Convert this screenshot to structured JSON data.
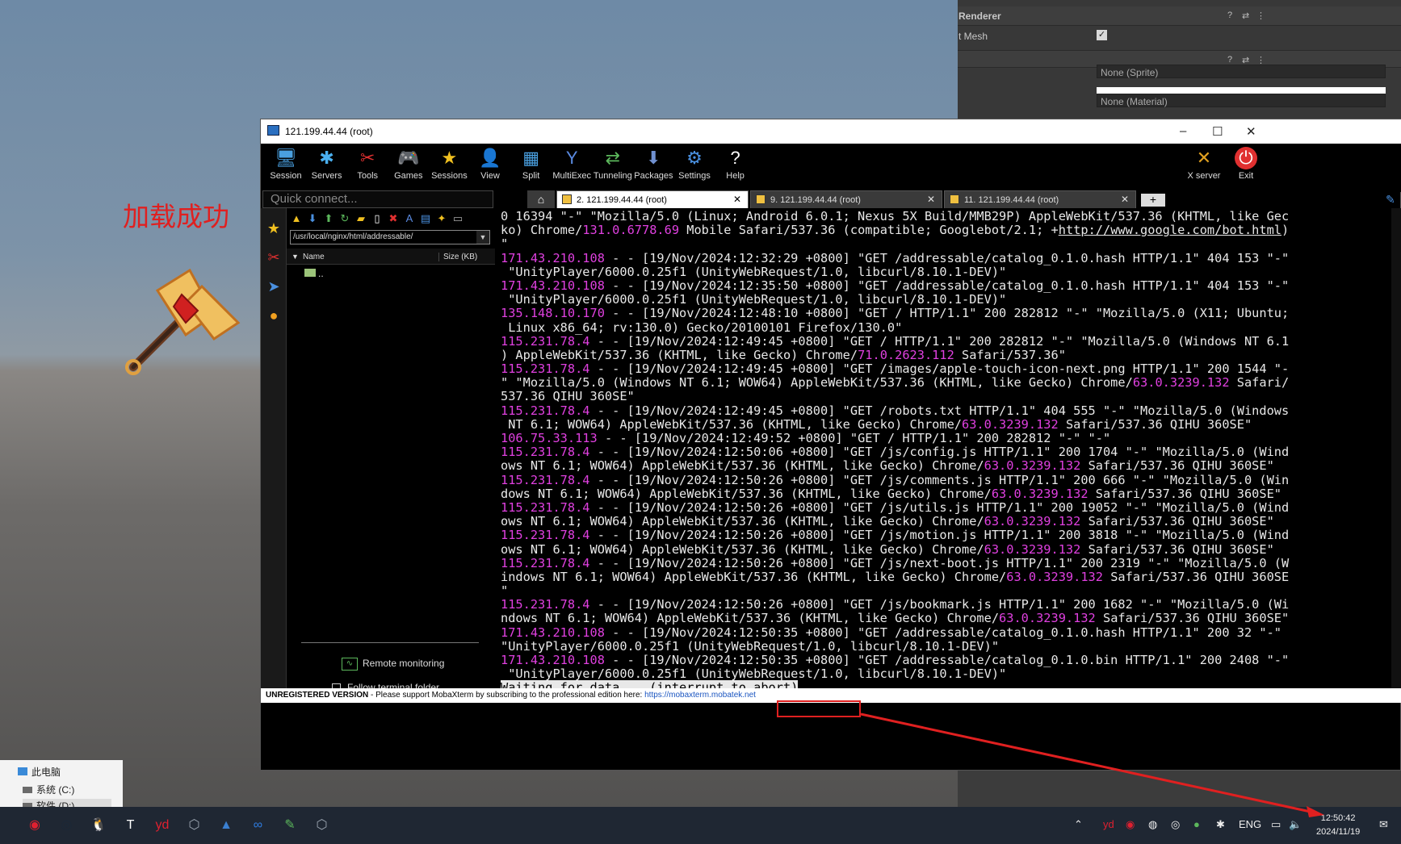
{
  "scene": {
    "title": "加载成功"
  },
  "inspector": {
    "header_title": "Renderer",
    "mesh_label": "t Mesh",
    "sprite_field": "None (Sprite)",
    "material_field": "None (Material)",
    "check": "✓"
  },
  "window": {
    "title": "121.199.44.44 (root)",
    "controls": [
      "–",
      "☐",
      "✕"
    ]
  },
  "toolbar": [
    {
      "label": "Session",
      "icon": "session-icon",
      "glyph": "🖥",
      "color": "#4aa0e0"
    },
    {
      "label": "Servers",
      "icon": "servers-icon",
      "glyph": "✱",
      "color": "#4ab0f0"
    },
    {
      "label": "Tools",
      "icon": "tools-icon",
      "glyph": "✂",
      "color": "#e03030"
    },
    {
      "label": "Games",
      "icon": "games-icon",
      "glyph": "🎮",
      "color": "#dddddd"
    },
    {
      "label": "Sessions",
      "icon": "sessions-icon",
      "glyph": "★",
      "color": "#f0c020"
    },
    {
      "label": "View",
      "icon": "view-icon",
      "glyph": "👤",
      "color": "#aaaaaa"
    },
    {
      "label": "Split",
      "icon": "split-icon",
      "glyph": "▦",
      "color": "#4aa0e0"
    },
    {
      "label": "MultiExec",
      "icon": "multiexec-icon",
      "glyph": "Y",
      "color": "#5a8ae0"
    },
    {
      "label": "Tunneling",
      "icon": "tunneling-icon",
      "glyph": "⇄",
      "color": "#5cb85c"
    },
    {
      "label": "Packages",
      "icon": "packages-icon",
      "glyph": "⬇",
      "color": "#7090d0"
    },
    {
      "label": "Settings",
      "icon": "settings-icon",
      "glyph": "⚙",
      "color": "#4a90e0"
    },
    {
      "label": "Help",
      "icon": "help-icon",
      "glyph": "?",
      "color": "#ffffff"
    }
  ],
  "toolbar_right": [
    {
      "label": "X server",
      "icon": "x-server-icon",
      "glyph": "✕",
      "color": "#e0a020"
    },
    {
      "label": "Exit",
      "icon": "exit-icon",
      "glyph": "⏻",
      "color": "#ffffff"
    }
  ],
  "quick_connect": {
    "placeholder": "Quick connect..."
  },
  "tabs": [
    {
      "label": "2. 121.199.44.44 (root)",
      "active": true
    },
    {
      "label": "9. 121.199.44.44 (root)",
      "active": false
    },
    {
      "label": "11. 121.199.44.44 (root)",
      "active": false
    }
  ],
  "tab_close": "✕",
  "browser": {
    "path": "/usr/local/nginx/html/addressable/",
    "col_name": "Name",
    "col_size": "Size (KB)",
    "parent": "..",
    "remote_monitoring": "Remote monitoring",
    "follow_terminal": "Follow terminal folder"
  },
  "console_lines": [
    [
      {
        "t": "0 16394 \"-\" \"Mozilla/5.0 (Linux; Android 6.0.1; Nexus 5X Build/MMB29P) AppleWebKit/537.36 (KHTML, like Gec"
      }
    ],
    [
      {
        "t": "ko) Chrome/"
      },
      {
        "t": "131.0.6778.69",
        "c": "ver"
      },
      {
        "t": " Mobile Safari/537.36 (compatible; Googlebot/2.1; +"
      },
      {
        "t": "http://www.google.com/bot.html",
        "c": "url"
      },
      {
        "t": ")"
      }
    ],
    [
      {
        "t": "\""
      }
    ],
    [
      {
        "t": "171.43.210.108",
        "c": "ip"
      },
      {
        "t": " - - [19/Nov/2024:12:32:29 +0800] \"GET /addressable/catalog_0.1.0.hash HTTP/1.1\" 404 153 \"-\""
      }
    ],
    [
      {
        "t": " \"UnityPlayer/6000.0.25f1 (UnityWebRequest/1.0, libcurl/8.10.1-DEV)\""
      }
    ],
    [
      {
        "t": "171.43.210.108",
        "c": "ip"
      },
      {
        "t": " - - [19/Nov/2024:12:35:50 +0800] \"GET /addressable/catalog_0.1.0.hash HTTP/1.1\" 404 153 \"-\""
      }
    ],
    [
      {
        "t": " \"UnityPlayer/6000.0.25f1 (UnityWebRequest/1.0, libcurl/8.10.1-DEV)\""
      }
    ],
    [
      {
        "t": "135.148.10.170",
        "c": "ip"
      },
      {
        "t": " - - [19/Nov/2024:12:48:10 +0800] \"GET / HTTP/1.1\" 200 282812 \"-\" \"Mozilla/5.0 (X11; Ubuntu;"
      }
    ],
    [
      {
        "t": " Linux x86_64; rv:130.0) Gecko/20100101 Firefox/130.0\""
      }
    ],
    [
      {
        "t": "115.231.78.4",
        "c": "ip"
      },
      {
        "t": " - - [19/Nov/2024:12:49:45 +0800] \"GET / HTTP/1.1\" 200 282812 \"-\" \"Mozilla/5.0 (Windows NT 6.1"
      }
    ],
    [
      {
        "t": ") AppleWebKit/537.36 (KHTML, like Gecko) Chrome/"
      },
      {
        "t": "71.0.2623.112",
        "c": "ver"
      },
      {
        "t": " Safari/537.36\""
      }
    ],
    [
      {
        "t": "115.231.78.4",
        "c": "ip"
      },
      {
        "t": " - - [19/Nov/2024:12:49:45 +0800] \"GET /images/apple-touch-icon-next.png HTTP/1.1\" 200 1544 \"-"
      }
    ],
    [
      {
        "t": "\" \"Mozilla/5.0 (Windows NT 6.1; WOW64) AppleWebKit/537.36 (KHTML, like Gecko) Chrome/"
      },
      {
        "t": "63.0.3239.132",
        "c": "ver"
      },
      {
        "t": " Safari/"
      }
    ],
    [
      {
        "t": "537.36 QIHU 360SE\""
      }
    ],
    [
      {
        "t": "115.231.78.4",
        "c": "ip"
      },
      {
        "t": " - - [19/Nov/2024:12:49:45 +0800] \"GET /robots.txt HTTP/1.1\" 404 555 \"-\" \"Mozilla/5.0 (Windows"
      }
    ],
    [
      {
        "t": " NT 6.1; WOW64) AppleWebKit/537.36 (KHTML, like Gecko) Chrome/"
      },
      {
        "t": "63.0.3239.132",
        "c": "ver"
      },
      {
        "t": " Safari/537.36 QIHU 360SE\""
      }
    ],
    [
      {
        "t": "106.75.33.113",
        "c": "ip"
      },
      {
        "t": " - - [19/Nov/2024:12:49:52 +0800] \"GET / HTTP/1.1\" 200 282812 \"-\" \"-\""
      }
    ],
    [
      {
        "t": "115.231.78.4",
        "c": "ip"
      },
      {
        "t": " - - [19/Nov/2024:12:50:06 +0800] \"GET /js/config.js HTTP/1.1\" 200 1704 \"-\" \"Mozilla/5.0 (Wind"
      }
    ],
    [
      {
        "t": "ows NT 6.1; WOW64) AppleWebKit/537.36 (KHTML, like Gecko) Chrome/"
      },
      {
        "t": "63.0.3239.132",
        "c": "ver"
      },
      {
        "t": " Safari/537.36 QIHU 360SE\""
      }
    ],
    [
      {
        "t": "115.231.78.4",
        "c": "ip"
      },
      {
        "t": " - - [19/Nov/2024:12:50:26 +0800] \"GET /js/comments.js HTTP/1.1\" 200 666 \"-\" \"Mozilla/5.0 (Win"
      }
    ],
    [
      {
        "t": "dows NT 6.1; WOW64) AppleWebKit/537.36 (KHTML, like Gecko) Chrome/"
      },
      {
        "t": "63.0.3239.132",
        "c": "ver"
      },
      {
        "t": " Safari/537.36 QIHU 360SE\""
      }
    ],
    [
      {
        "t": "115.231.78.4",
        "c": "ip"
      },
      {
        "t": " - - [19/Nov/2024:12:50:26 +0800] \"GET /js/utils.js HTTP/1.1\" 200 19052 \"-\" \"Mozilla/5.0 (Wind"
      }
    ],
    [
      {
        "t": "ows NT 6.1; WOW64) AppleWebKit/537.36 (KHTML, like Gecko) Chrome/"
      },
      {
        "t": "63.0.3239.132",
        "c": "ver"
      },
      {
        "t": " Safari/537.36 QIHU 360SE\""
      }
    ],
    [
      {
        "t": "115.231.78.4",
        "c": "ip"
      },
      {
        "t": " - - [19/Nov/2024:12:50:26 +0800] \"GET /js/motion.js HTTP/1.1\" 200 3818 \"-\" \"Mozilla/5.0 (Wind"
      }
    ],
    [
      {
        "t": "ows NT 6.1; WOW64) AppleWebKit/537.36 (KHTML, like Gecko) Chrome/"
      },
      {
        "t": "63.0.3239.132",
        "c": "ver"
      },
      {
        "t": " Safari/537.36 QIHU 360SE\""
      }
    ],
    [
      {
        "t": "115.231.78.4",
        "c": "ip"
      },
      {
        "t": " - - [19/Nov/2024:12:50:26 +0800] \"GET /js/next-boot.js HTTP/1.1\" 200 2319 \"-\" \"Mozilla/5.0 (W"
      }
    ],
    [
      {
        "t": "indows NT 6.1; WOW64) AppleWebKit/537.36 (KHTML, like Gecko) Chrome/"
      },
      {
        "t": "63.0.3239.132",
        "c": "ver"
      },
      {
        "t": " Safari/537.36 QIHU 360SE"
      }
    ],
    [
      {
        "t": "\""
      }
    ],
    [
      {
        "t": "115.231.78.4",
        "c": "ip"
      },
      {
        "t": " - - [19/Nov/2024:12:50:26 +0800] \"GET /js/bookmark.js HTTP/1.1\" 200 1682 \"-\" \"Mozilla/5.0 (Wi"
      }
    ],
    [
      {
        "t": "ndows NT 6.1; WOW64) AppleWebKit/537.36 (KHTML, like Gecko) Chrome/"
      },
      {
        "t": "63.0.3239.132",
        "c": "ver"
      },
      {
        "t": " Safari/537.36 QIHU 360SE\""
      }
    ],
    [
      {
        "t": "171.43.210.108",
        "c": "ip"
      },
      {
        "t": " - - [19/Nov/2024:12:50:35 +0800] \"GET /addressable/catalog_0.1.0.hash HTTP/1.1\" 200 32 \"-\""
      }
    ],
    [
      {
        "t": "\"UnityPlayer/6000.0.25f1 (UnityWebRequest/1.0, libcurl/8.10.1-DEV)\""
      }
    ],
    [
      {
        "t": "171.43.210.108",
        "c": "ip"
      },
      {
        "t": " - - [19/Nov/2024:12:50:35 +0800] \"GET /addressable/catalog_0.1.0.bin HTTP/1.1\" 200 2408 \"-\""
      }
    ],
    [
      {
        "t": " \"UnityPlayer/6000.0.25f1 (UnityWebRequest/1.0, libcurl/8.10.1-DEV)\""
      }
    ],
    [
      {
        "t": "Waiting for data... (interrupt to abort)",
        "c": "cursor"
      }
    ]
  ],
  "status": {
    "bold": "UNREGISTERED VERSION",
    "text": "  -  Please support MobaXterm by subscribing to the professional edition here: ",
    "link": "https://mobaxterm.mobatek.net"
  },
  "explorer": {
    "item1": "此电脑",
    "item2": "系统 (C:)",
    "item3": "软件 (D:)"
  },
  "taskbar": {
    "apps": [
      {
        "icon": "netease-music-icon",
        "glyph": "◉",
        "color": "#e02030"
      },
      {
        "icon": "steam-icon",
        "glyph": "◎",
        "color": "#1b2838"
      },
      {
        "icon": "qq-icon",
        "glyph": "🐧",
        "color": "#ffffff"
      },
      {
        "icon": "typora-icon",
        "glyph": "T",
        "color": "#ffffff"
      },
      {
        "icon": "youdao-icon",
        "glyph": "yd",
        "color": "#e02030"
      },
      {
        "icon": "unity-icon",
        "glyph": "⬡",
        "color": "#9aa4b0"
      },
      {
        "icon": "photos-icon",
        "glyph": "▲",
        "color": "#3a7fd0"
      },
      {
        "icon": "feishu-icon",
        "glyph": "∞",
        "color": "#2f7de0"
      },
      {
        "icon": "notepad-icon",
        "glyph": "✎",
        "color": "#5cb85c"
      },
      {
        "icon": "unity-hub-icon",
        "glyph": "⬡",
        "color": "#9aa4b0"
      }
    ],
    "tray_lang": "ENG",
    "time": "12:50:42",
    "date": "2024/11/19"
  }
}
